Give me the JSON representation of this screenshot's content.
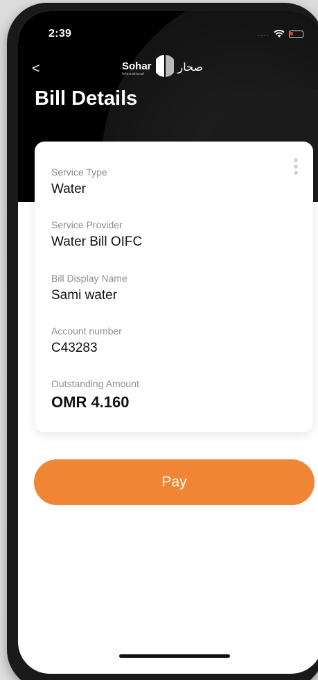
{
  "status_bar": {
    "time": "2:39",
    "signal": "....",
    "wifi_icon": "wifi-icon",
    "battery_icon": "battery-low-icon",
    "battery_color": "#e23b2e"
  },
  "header": {
    "back_icon": "chevron-left-icon",
    "back_glyph": "<",
    "logo": {
      "en": "Sohar",
      "en_sub": "International",
      "ar": "صحار"
    },
    "title": "Bill Details"
  },
  "card": {
    "menu_icon": "kebab-menu-icon",
    "fields": [
      {
        "label": "Service Type",
        "value": "Water"
      },
      {
        "label": "Service Provider",
        "value": "Water Bill OIFC"
      },
      {
        "label": "Bill Display Name",
        "value": "Sami water"
      },
      {
        "label": "Account number",
        "value": "C43283"
      },
      {
        "label": "Outstanding Amount",
        "value": "OMR 4.160"
      }
    ]
  },
  "pay": {
    "label": "Pay",
    "color": "#ef8535"
  },
  "colors": {
    "header_bg": "#000000",
    "accent": "#ef8535"
  }
}
